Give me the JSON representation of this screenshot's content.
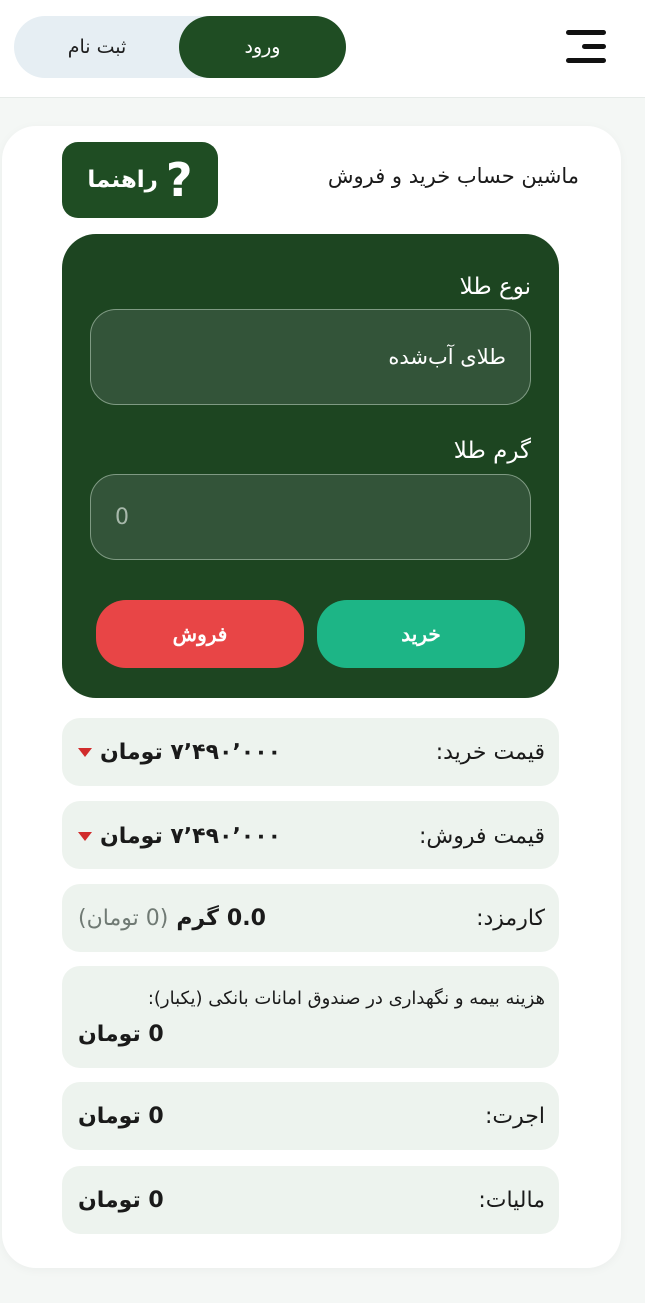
{
  "header": {
    "menu_icon": "hamburger-menu-icon",
    "login_label": "ورود",
    "signup_label": "ثبت نام"
  },
  "calculator": {
    "title": "ماشین حساب خرید و فروش",
    "help_label": "راهنما",
    "help_icon": "question-mark-icon",
    "gold_type_label": "نوع طلا",
    "gold_type_value": "طلای آب‌شده",
    "gram_label": "گرم طلا",
    "gram_value": "0",
    "buy_label": "خرید",
    "sell_label": "فروش"
  },
  "prices": {
    "buy_price_label": "قیمت خرید:",
    "buy_price_value": "۷٬۴۹۰٬۰۰۰ تومان",
    "sell_price_label": "قیمت فروش:",
    "sell_price_value": "۷٬۴۹۰٬۰۰۰ تومان",
    "fee_label": "کارمزد:",
    "fee_gram": "0.0",
    "fee_unit": "گرم",
    "fee_toman": "(0 تومان)",
    "insurance_label": "هزینه بیمه و نگهداری در صندوق امانات بانکی (یکبار):",
    "insurance_value": "0 تومان",
    "wage_label": "اجرت:",
    "wage_value": "0 تومان",
    "tax_label": "مالیات:",
    "tax_value": "0 تومان"
  },
  "colors": {
    "primary_green": "#1f4d23",
    "panel_green": "#1d4521",
    "buy": "#1db586",
    "sell": "#e84546",
    "price_down": "#d12c2c"
  }
}
